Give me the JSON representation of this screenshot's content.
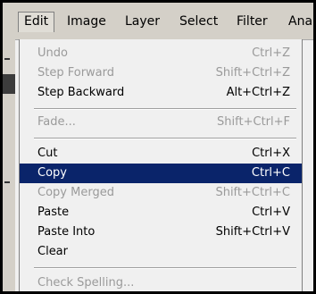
{
  "menubar": {
    "menus": [
      {
        "label": "Edit"
      },
      {
        "label": "Image"
      },
      {
        "label": "Layer"
      },
      {
        "label": "Select"
      },
      {
        "label": "Filter"
      },
      {
        "label": "Analy"
      }
    ],
    "open_menu": "Edit"
  },
  "edit_menu": {
    "items": [
      {
        "label": "Undo",
        "shortcut": "Ctrl+Z",
        "enabled": false
      },
      {
        "label": "Step Forward",
        "shortcut": "Shift+Ctrl+Z",
        "enabled": false
      },
      {
        "label": "Step Backward",
        "shortcut": "Alt+Ctrl+Z",
        "enabled": true
      },
      {
        "label": "Fade...",
        "shortcut": "Shift+Ctrl+F",
        "enabled": false
      },
      {
        "label": "Cut",
        "shortcut": "Ctrl+X",
        "enabled": true
      },
      {
        "label": "Copy",
        "shortcut": "Ctrl+C",
        "enabled": true,
        "highlighted": true
      },
      {
        "label": "Copy Merged",
        "shortcut": "Shift+Ctrl+C",
        "enabled": false
      },
      {
        "label": "Paste",
        "shortcut": "Ctrl+V",
        "enabled": true
      },
      {
        "label": "Paste Into",
        "shortcut": "Shift+Ctrl+V",
        "enabled": true
      },
      {
        "label": "Clear",
        "shortcut": "",
        "enabled": true
      },
      {
        "label": "Check Spelling...",
        "shortcut": "",
        "enabled": false
      }
    ]
  },
  "colors": {
    "highlight": "#0a246a",
    "disabled_text": "#9a9a9a",
    "menu_bg": "#f0f0f0"
  }
}
